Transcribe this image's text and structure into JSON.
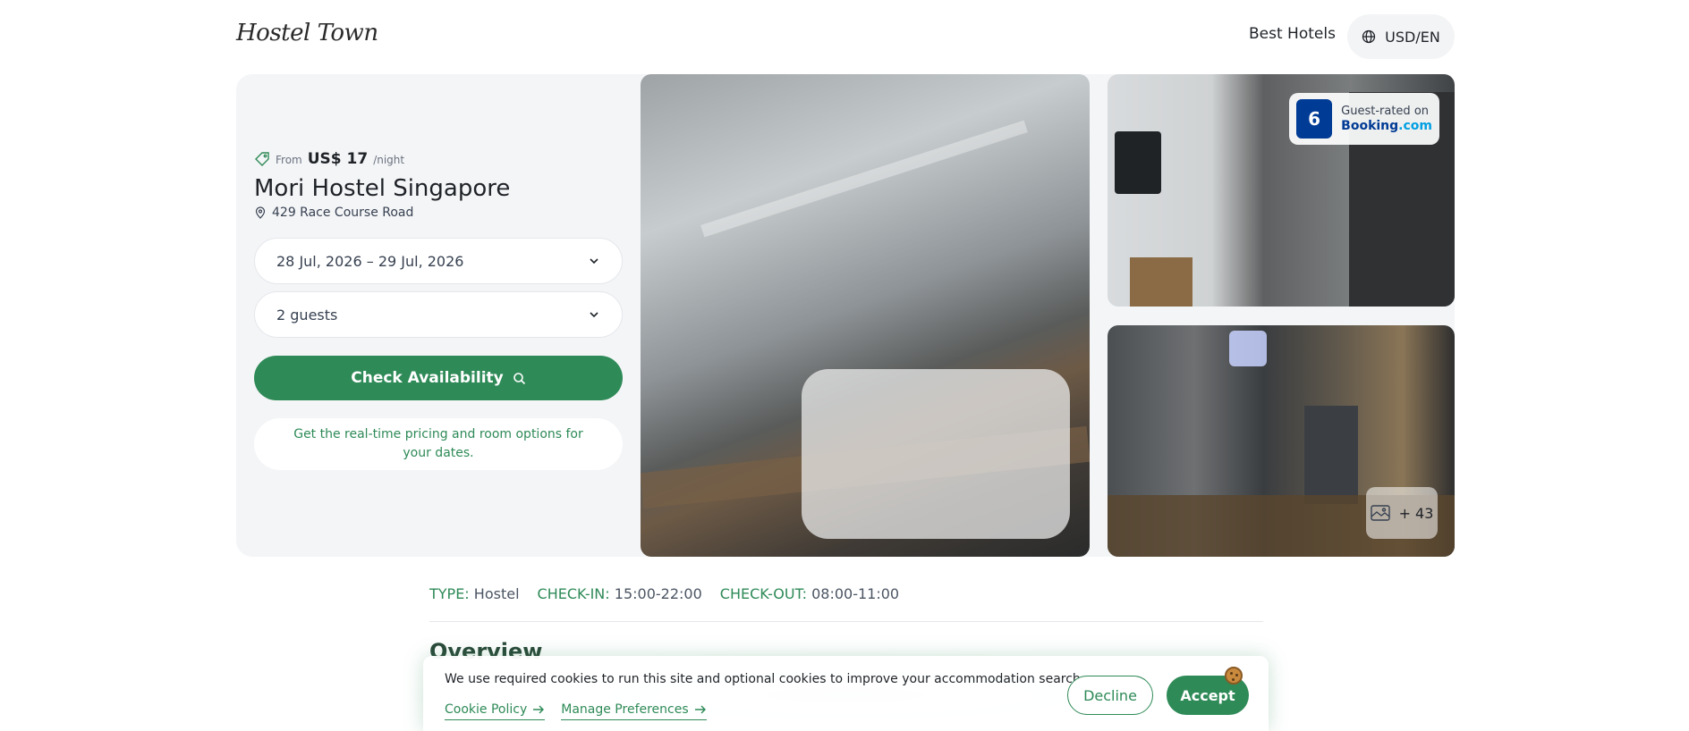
{
  "header": {
    "logo": "Hostel Town",
    "nav_link": "Best Hotels",
    "currency": "USD/EN",
    "currency_icon": "globe-icon"
  },
  "booking": {
    "price_prefix": "From",
    "price": "US$ 17",
    "price_suffix": "/night",
    "hotel_name": "Mori Hostel Singapore",
    "address": "429 Race Course Road",
    "dates": "28 Jul, 2026 – 29 Jul, 2026",
    "guests": "2 guests",
    "check_button": "Check Availability",
    "info_text": "Get the real-time pricing and room options for your dates."
  },
  "gallery": {
    "rating_score": "6",
    "rating_label": "Guest-rated on",
    "rating_brand": "Booking",
    "rating_brand_suffix": ".com",
    "photo_count": "+ 43"
  },
  "details": {
    "type_label": "TYPE:",
    "type_value": "Hostel",
    "checkin_label": "CHECK-IN:",
    "checkin_value": "15:00-22:00",
    "checkout_label": "CHECK-OUT:",
    "checkout_value": "08:00-11:00",
    "overview_title": "Overview"
  },
  "cookie": {
    "message": "We use required cookies to run this site and optional cookies to improve your accommodation search.",
    "policy_link": "Cookie Policy",
    "preferences_link": "Manage Preferences",
    "decline": "Decline",
    "accept": "Accept"
  },
  "colors": {
    "brand_green": "#2e8a57",
    "booking_blue": "#003b95",
    "panel_bg": "#f4f5f7"
  }
}
